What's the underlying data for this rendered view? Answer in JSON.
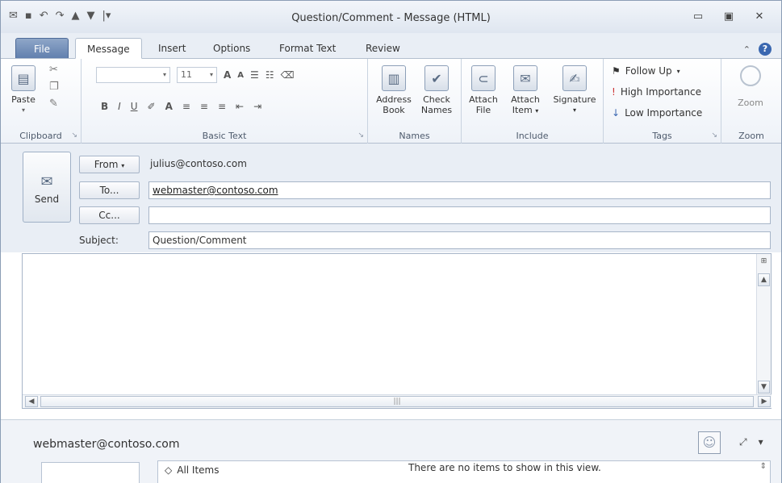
{
  "window": {
    "title": "Question/Comment - Message (HTML)"
  },
  "qat": {
    "icons": [
      "outlook-icon",
      "save-icon",
      "undo-icon",
      "redo-icon",
      "up-arrow-icon",
      "down-arrow-icon",
      "customize-icon"
    ]
  },
  "tabs": {
    "file": "File",
    "message": "Message",
    "insert": "Insert",
    "options": "Options",
    "format_text": "Format Text",
    "review": "Review"
  },
  "ribbon": {
    "clipboard": {
      "label": "Clipboard",
      "paste": "Paste"
    },
    "basic_text": {
      "label": "Basic Text",
      "font_size": "11",
      "bold": "B",
      "italic": "I",
      "underline": "U"
    },
    "names": {
      "label": "Names",
      "address_book_line1": "Address",
      "address_book_line2": "Book",
      "check_names_line1": "Check",
      "check_names_line2": "Names"
    },
    "include": {
      "label": "Include",
      "attach_file_line1": "Attach",
      "attach_file_line2": "File",
      "attach_item_line1": "Attach",
      "attach_item_line2": "Item",
      "signature": "Signature"
    },
    "tags": {
      "label": "Tags",
      "follow_up": "Follow Up",
      "high_importance": "High Importance",
      "low_importance": "Low Importance"
    },
    "zoom": {
      "label": "Zoom",
      "zoom_button": "Zoom"
    }
  },
  "compose": {
    "send_label": "Send",
    "from_button": "From",
    "from_value": "julius@contoso.com",
    "to_button": "To...",
    "to_value": "webmaster@contoso.com",
    "cc_button": "Cc...",
    "cc_value": "",
    "subject_label": "Subject:",
    "subject_value": "Question/Comment"
  },
  "people_pane": {
    "name": "webmaster@contoso.com",
    "all_items": "All Items",
    "empty_message": "There are no items to show in this view."
  }
}
